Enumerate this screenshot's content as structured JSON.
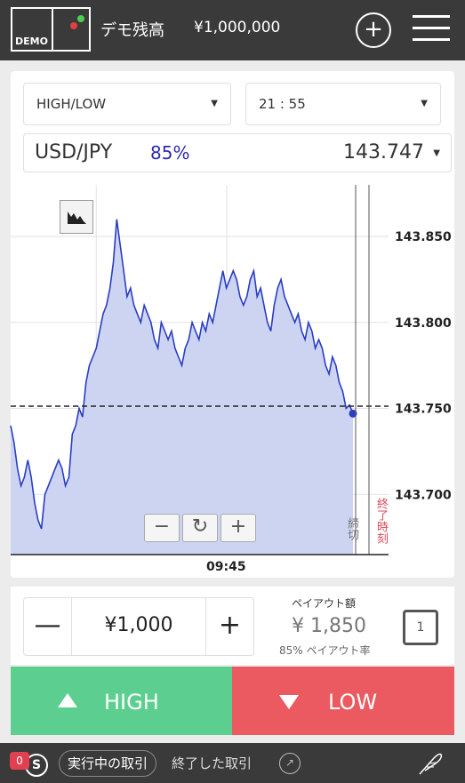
{
  "header": {
    "logo_text": "DEMO",
    "balance_label": "デモ残高",
    "balance_value": "¥1,000,000",
    "add_symbol": "+"
  },
  "selectors": {
    "trade_type": "HIGH/LOW",
    "expiry_time": "21 : 55"
  },
  "asset": {
    "pair": "USD/JPY",
    "payout_pct": "85%",
    "price": "143.747"
  },
  "chart_data": {
    "type": "area",
    "xlabel": "",
    "ylabel": "",
    "x_tick_labels": [
      "09:45"
    ],
    "y_ticks": [
      143.7,
      143.75,
      143.8,
      143.85
    ],
    "y_tick_labels": [
      "143.850",
      "143.800",
      "143.750",
      "143.700"
    ],
    "ylim": [
      143.665,
      143.88
    ],
    "current_price": 143.747,
    "grid": true,
    "series": [
      {
        "values": [
          143.74,
          143.73,
          143.715,
          143.705,
          143.71,
          143.72,
          143.71,
          143.695,
          143.685,
          143.68,
          143.7,
          143.705,
          143.71,
          143.715,
          143.72,
          143.715,
          143.705,
          143.71,
          143.735,
          143.74,
          143.75,
          143.745,
          143.765,
          143.775,
          143.78,
          143.785,
          143.795,
          143.805,
          143.81,
          143.82,
          143.835,
          143.86,
          143.845,
          143.83,
          143.815,
          143.82,
          143.81,
          143.805,
          143.8,
          143.81,
          143.805,
          143.8,
          143.79,
          143.785,
          143.8,
          143.795,
          143.79,
          143.795,
          143.785,
          143.78,
          143.775,
          143.785,
          143.79,
          143.8,
          143.795,
          143.79,
          143.8,
          143.795,
          143.805,
          143.8,
          143.81,
          143.82,
          143.83,
          143.82,
          143.825,
          143.83,
          143.825,
          143.815,
          143.81,
          143.815,
          143.825,
          143.83,
          143.815,
          143.82,
          143.81,
          143.8,
          143.795,
          143.81,
          143.82,
          143.825,
          143.815,
          143.81,
          143.805,
          143.8,
          143.805,
          143.795,
          143.79,
          143.8,
          143.795,
          143.785,
          143.79,
          143.785,
          143.775,
          143.77,
          143.78,
          143.775,
          143.765,
          143.76,
          143.75,
          143.752,
          143.747
        ]
      }
    ],
    "markers": {
      "deadline_label": "締切",
      "end_time_label": "終了時刻"
    },
    "colors": {
      "line": "#2a3ec0",
      "fill": "#ccd4f2",
      "end_time_text": "#d9485a"
    }
  },
  "chart_controls": {
    "zoom_out": "−",
    "refresh": "↻",
    "zoom_in": "+"
  },
  "trade": {
    "minus": "—",
    "plus": "+",
    "amount": "¥1,000",
    "payout_label": "ペイアウト額",
    "payout_value": "¥ 1,850",
    "payout_rate": "85% ペイアウト率",
    "ticket_count": "1"
  },
  "buttons": {
    "high": "HIGH",
    "low": "LOW",
    "high_color": "#5ccf90",
    "low_color": "#ea5a60"
  },
  "footer": {
    "badge_count": "0",
    "tab_active": "実行中の取引",
    "tab_inactive": "終了した取引"
  }
}
